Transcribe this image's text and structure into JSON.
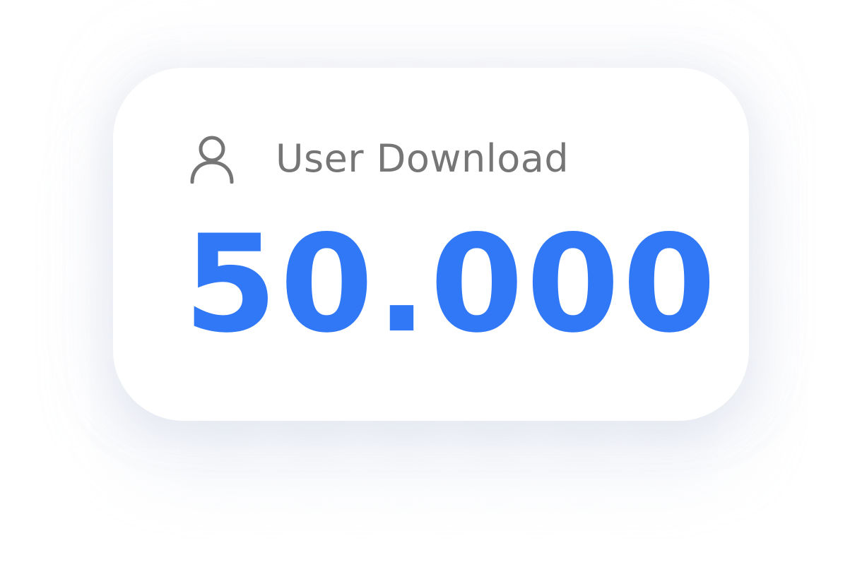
{
  "stat_card": {
    "icon": "user-icon",
    "label": "User Download",
    "value": "50.000",
    "colors": {
      "value": "#3178f6",
      "label": "#767676",
      "icon": "#767676",
      "card_background": "#ffffff"
    }
  }
}
